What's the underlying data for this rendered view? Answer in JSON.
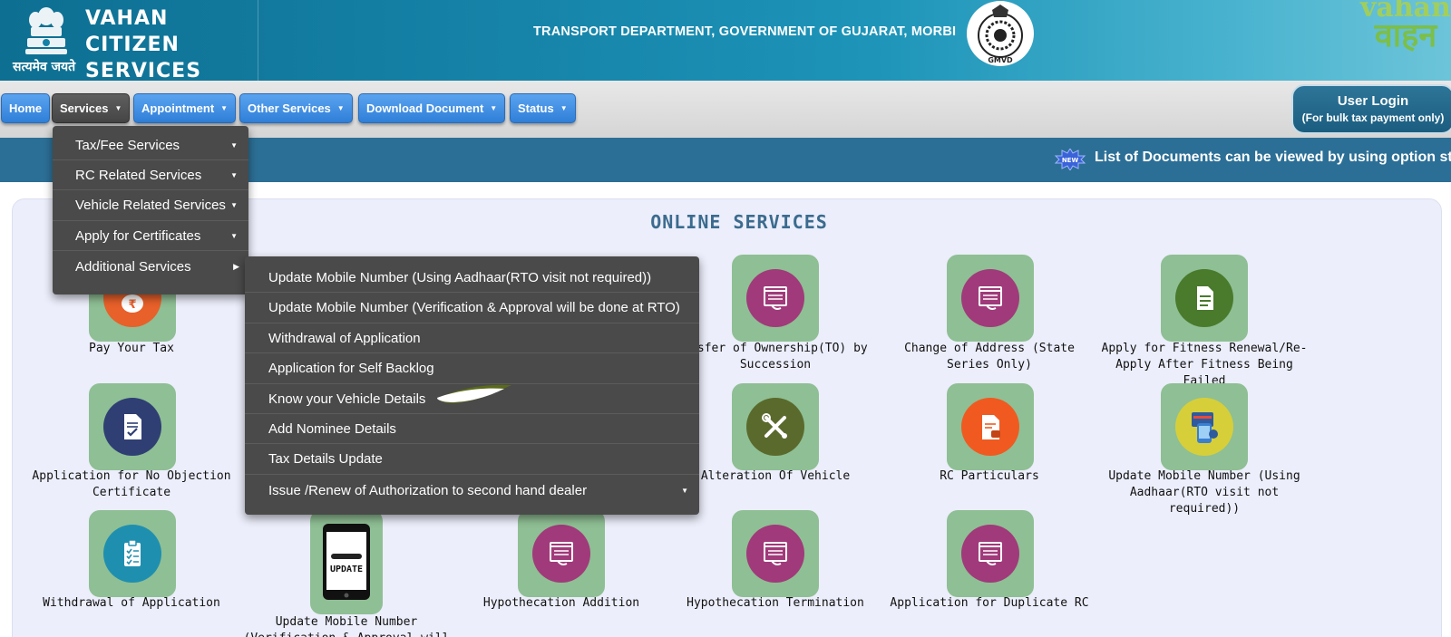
{
  "header": {
    "title_line1": "VAHAN CITIZEN",
    "title_line2": "SERVICES",
    "tagline": "सत्यमेव जयते",
    "department": "TRANSPORT DEPARTMENT, GOVERNMENT OF GUJARAT, MORBI",
    "seal_text": "GMVD",
    "brand_line1": "vahan",
    "brand_line2": "वाहन"
  },
  "nav": {
    "items": [
      {
        "label": "Home"
      },
      {
        "label": "Services"
      },
      {
        "label": "Appointment"
      },
      {
        "label": "Other Services"
      },
      {
        "label": "Download Document"
      },
      {
        "label": "Status"
      }
    ],
    "user_login_line1": "User Login",
    "user_login_line2": "(For bulk tax payment only)"
  },
  "marquee": {
    "badge_text": "NEW",
    "text": "List of Documents can be viewed by using option sta"
  },
  "main": {
    "title": "ONLINE SERVICES",
    "tiles": [
      {
        "label": "Pay Your Tax",
        "icon": "rupee-bag-icon",
        "color": "#e8602a"
      },
      {
        "label": "ansfer of Ownership(TO) by Succession",
        "icon": "document-window-icon",
        "color": "#a03a7a"
      },
      {
        "label": "Change of Address (State Series Only)",
        "icon": "document-window-icon",
        "color": "#a03a7a"
      },
      {
        "label": "Apply for Fitness Renewal/Re-Apply After Fitness Being Failed",
        "icon": "document-lines-icon",
        "color": "#4a7a2c"
      },
      {
        "label": "Application for No Objection Certificate",
        "icon": "certificate-check-icon",
        "color": "#2f3f74"
      },
      {
        "label": "Alteration Of Vehicle",
        "icon": "wrench-screwdriver-icon",
        "color": "#5a6a2c"
      },
      {
        "label": "RC Particulars",
        "icon": "rc-document-icon",
        "color": "#f05a20"
      },
      {
        "label": "Update Mobile Number (Using Aadhaar(RTO visit not required))",
        "icon": "mobile-card-icon",
        "color": "#d6cf3a"
      },
      {
        "label": "Withdrawal of Application",
        "icon": "clipboard-check-icon",
        "color": "#1f8fb0"
      },
      {
        "label": "Update Mobile Number (Verification & Approval will be",
        "icon": "phone-update-icon",
        "screen_text": "UPDATE"
      },
      {
        "label": "Hypothecation Addition",
        "icon": "document-window-icon",
        "color": "#a03a7a"
      },
      {
        "label": "Hypothecation Termination",
        "icon": "document-window-icon",
        "color": "#a03a7a"
      },
      {
        "label": "Application for Duplicate RC",
        "icon": "document-window-icon",
        "color": "#a03a7a"
      }
    ]
  },
  "services_menu": {
    "items": [
      {
        "label": "Tax/Fee Services"
      },
      {
        "label": "RC Related Services"
      },
      {
        "label": "Vehicle Related Services"
      },
      {
        "label": "Apply for Certificates"
      },
      {
        "label": "Additional Services"
      }
    ]
  },
  "additional_menu": {
    "items": [
      {
        "label": "Update Mobile Number (Using Aadhaar(RTO visit not required))"
      },
      {
        "label": "Update Mobile Number (Verification & Approval will be done at RTO)"
      },
      {
        "label": "Withdrawal of Application"
      },
      {
        "label": "Application for Self Backlog"
      },
      {
        "label": "Know your Vehicle Details"
      },
      {
        "label": "Add Nominee Details"
      },
      {
        "label": "Tax Details Update"
      },
      {
        "label": "Issue /Renew of Authorization to second hand dealer"
      }
    ]
  },
  "colors": {
    "tile_bg": "#8fbf94",
    "nav_blue": "#3d8de0",
    "menu_bg": "#4a4a4a",
    "marquee_bg": "#2c6f96",
    "title_color": "#3b6b8e"
  }
}
